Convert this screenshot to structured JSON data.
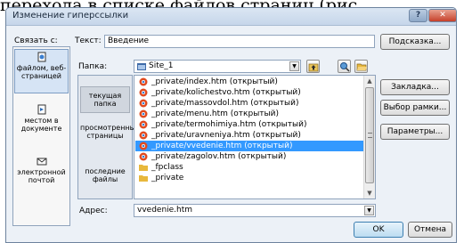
{
  "background_text": "перехода в списке файлов страниц (рис",
  "window": {
    "title": "Изменение гиперссылки",
    "help_button": "?",
    "close_button": "✕"
  },
  "link_to": {
    "label": "Связать с:",
    "items": [
      {
        "label": "файлом, веб-страницей",
        "icon": "web-page-icon"
      },
      {
        "label": "местом в документе",
        "icon": "document-place-icon"
      },
      {
        "label": "электронной почтой",
        "icon": "email-icon"
      }
    ]
  },
  "text_field": {
    "label": "Текст:",
    "value": "Введение"
  },
  "tooltip_button": "Подсказка...",
  "folder": {
    "label": "Папка:",
    "value": "Site_1"
  },
  "side_buttons": {
    "bookmark": "Закладка...",
    "target_frame": "Выбор рамки...",
    "parameters": "Параметры..."
  },
  "look_in": [
    {
      "label": "текущая папка"
    },
    {
      "label": "просмотренные страницы"
    },
    {
      "label": "последние файлы"
    }
  ],
  "files": [
    {
      "name": "_private/index.htm (открытый)",
      "type": "web"
    },
    {
      "name": "_private/kolichestvo.htm (открытый)",
      "type": "web"
    },
    {
      "name": "_private/massovdol.htm (открытый)",
      "type": "web"
    },
    {
      "name": "_private/menu.htm (открытый)",
      "type": "web"
    },
    {
      "name": "_private/termohimiya.htm (открытый)",
      "type": "web"
    },
    {
      "name": "_private/uravneniya.htm (открытый)",
      "type": "web"
    },
    {
      "name": "_private/vvedenie.htm (открытый)",
      "type": "web",
      "selected": true
    },
    {
      "name": "_private/zagolov.htm (открытый)",
      "type": "web"
    },
    {
      "name": "_fpclass",
      "type": "folder"
    },
    {
      "name": "_private",
      "type": "folder"
    }
  ],
  "address": {
    "label": "Адрес:",
    "value": "vvedenie.htm"
  },
  "ok_button": "OK",
  "cancel_button": "Отмена",
  "colors": {
    "selection": "#3399ff",
    "dialog_bg": "#ecf1f7",
    "folder": "#e8b83c",
    "browser_icon": "#e04a1f"
  }
}
